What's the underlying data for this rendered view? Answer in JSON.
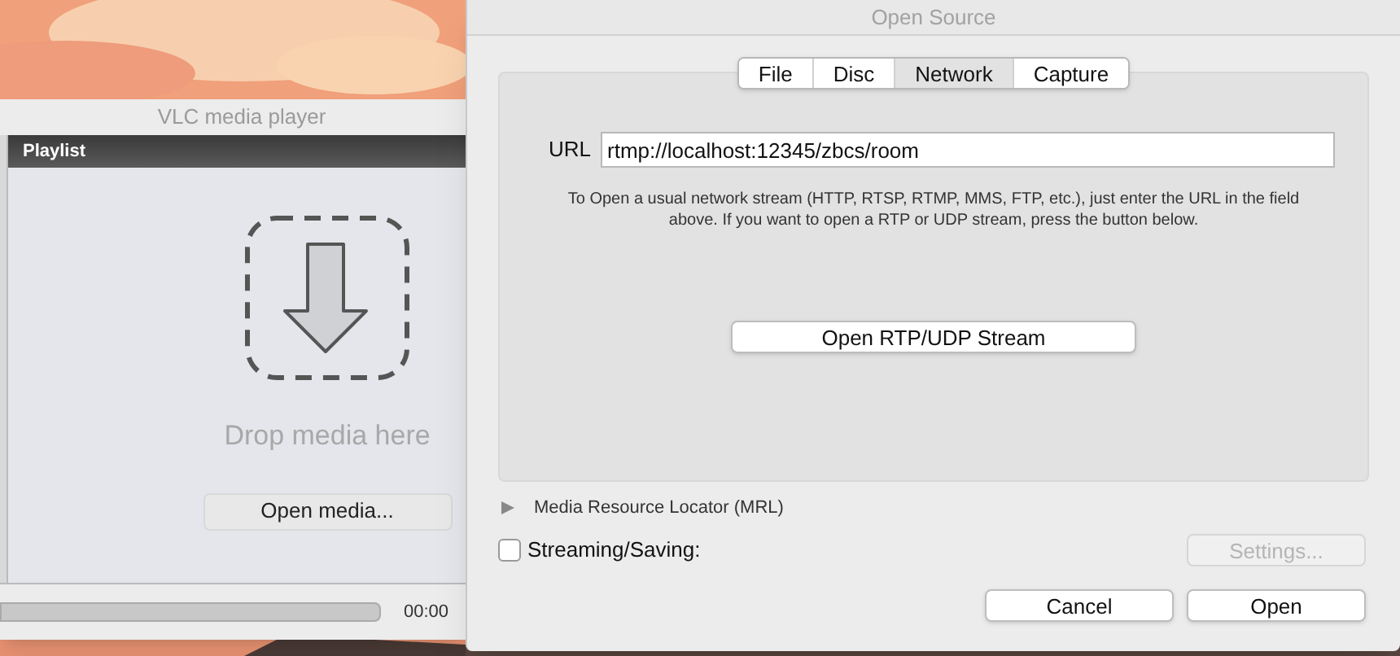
{
  "player_window": {
    "title": "VLC media player",
    "playlist_header": "Playlist",
    "drop_text": "Drop media here",
    "open_media_button": "Open media...",
    "time": "00:00"
  },
  "dialog": {
    "title": "Open Source",
    "tabs": [
      {
        "label": "File",
        "selected": false
      },
      {
        "label": "Disc",
        "selected": false
      },
      {
        "label": "Network",
        "selected": true
      },
      {
        "label": "Capture",
        "selected": false
      }
    ],
    "url_label": "URL",
    "url_value": "rtmp://localhost:12345/zbcs/room",
    "help_text": "To Open a usual network stream (HTTP, RTSP, RTMP, MMS, FTP, etc.), just enter the URL in the field above. If you want to open a RTP or UDP stream, press the button below.",
    "rtp_button": "Open RTP/UDP Stream",
    "mrl": {
      "label": "Media Resource Locator (MRL)",
      "expanded": false
    },
    "streaming": {
      "label": "Streaming/Saving:",
      "checked": false
    },
    "settings_button": {
      "label": "Settings...",
      "disabled": true
    },
    "buttons": [
      "Cancel",
      "Open"
    ]
  }
}
